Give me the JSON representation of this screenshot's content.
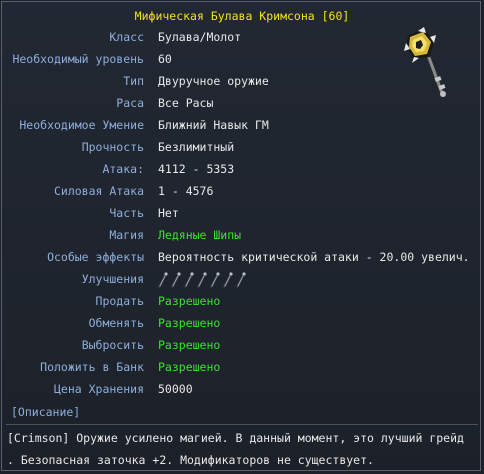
{
  "item": {
    "title": "Мифическая Булава Кримсона [60]",
    "icon": "mace-icon"
  },
  "stats": [
    {
      "label": "Класс",
      "value": "Булава/Молот",
      "color": "#e8e8e8"
    },
    {
      "label": "Необходимый уровень",
      "value": "60",
      "color": "#e8e8e8"
    },
    {
      "label": "Тип",
      "value": "Двуручное оружие",
      "color": "#e8e8e8"
    },
    {
      "label": "Раса",
      "value": "Все Расы",
      "color": "#e8e8e8"
    },
    {
      "label": "Необходимое Умение",
      "value": "Ближний Навык ГМ",
      "color": "#e8e8e8"
    },
    {
      "label": "Прочность",
      "value": "Безлимитный",
      "color": "#e8e8e8"
    },
    {
      "label": "Атака:",
      "value": "4112 - 5353",
      "color": "#e8e8e8"
    },
    {
      "label": "Силовая Атака",
      "value": "1 - 4576",
      "color": "#e8e8e8"
    },
    {
      "label": "Часть",
      "value": "Нет",
      "color": "#e8e8e8"
    },
    {
      "label": "Магия",
      "value": "Ледяные Шипы",
      "color": "#36e52a"
    },
    {
      "label": "Особые эффекты",
      "value": "Вероятность критической атаки - 20.00 увелич.",
      "color": "#e8e8e8"
    },
    {
      "label": "Улучшения",
      "value": "",
      "color": "#e8e8e8"
    },
    {
      "label": "Продать",
      "value": "Разрешено",
      "color": "#36e52a"
    },
    {
      "label": "Обменять",
      "value": "Разрешено",
      "color": "#36e52a"
    },
    {
      "label": "Выбросить",
      "value": "Разрешено",
      "color": "#36e52a"
    },
    {
      "label": "Положить в Банк",
      "value": "Разрешено",
      "color": "#36e52a"
    },
    {
      "label": "Цена Хранения",
      "value": "50000",
      "color": "#e8e8e8"
    }
  ],
  "upgrades": {
    "slots": 7,
    "filled": 0,
    "icon": "upgrade-slot-icon"
  },
  "description": {
    "header": "[Описание]",
    "line1": "[Crimson] Оружие усилено магией. В данный момент, это лучший грейд",
    "line2": ". Безопасная заточка +2. Модификаторов не существует."
  },
  "colors": {
    "title": "#f4e21a",
    "label": "#8faedb",
    "value": "#e8e8e8",
    "allowed": "#36e52a"
  }
}
